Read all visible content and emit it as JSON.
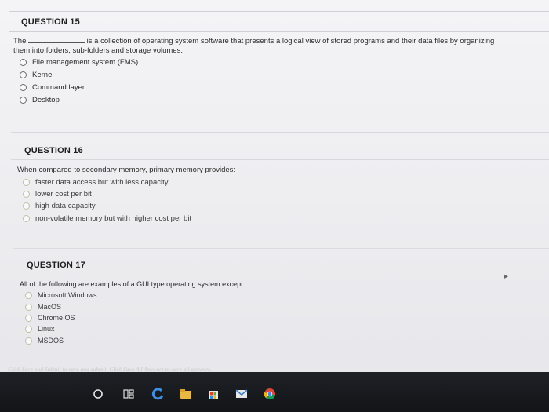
{
  "q15": {
    "title": "QUESTION 15",
    "stem_prefix": "The",
    "stem_line1": "is a collection of operating system software that presents a logical view of stored programs and their data files by organizing",
    "stem_line2": "them into folders, sub-folders and storage volumes.",
    "options": [
      "File management system (FMS)",
      "Kernel",
      "Command layer",
      "Desktop"
    ]
  },
  "q16": {
    "title": "QUESTION 16",
    "stem": "When compared to secondary memory, primary memory provides:",
    "options": [
      "faster data access but with less capacity",
      "lower cost per bit",
      "high data capacity",
      "non-volatile memory but with higher cost per bit"
    ]
  },
  "q17": {
    "title": "QUESTION 17",
    "stem": "All of the following are examples of a GUI type operating system except:",
    "options": [
      "Microsoft Windows",
      "MacOS",
      "Chrome OS",
      "Linux",
      "MSDOS"
    ]
  },
  "footer": {
    "note": "Click Save and Submit to save and submit. Click Save All Answers to save all answers."
  },
  "taskbar": {
    "icons": [
      "search-circle-icon",
      "task-view-icon",
      "edge-icon",
      "file-explorer-icon",
      "store-icon",
      "mail-icon",
      "chrome-icon"
    ]
  }
}
